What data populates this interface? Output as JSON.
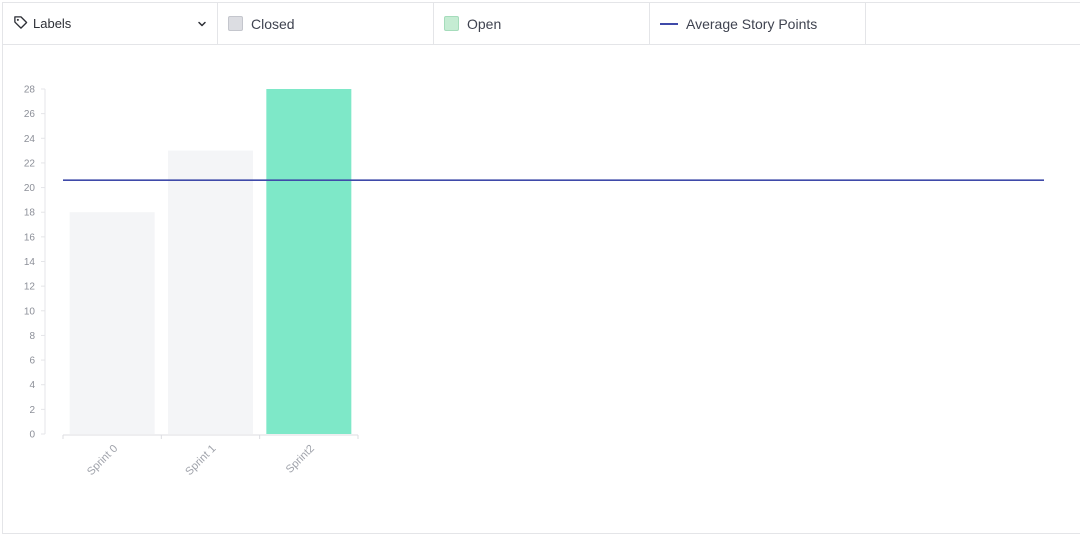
{
  "toolbar": {
    "dropdown_label": "Labels",
    "legend_closed": "Closed",
    "legend_open": "Open",
    "legend_average": "Average Story Points"
  },
  "colors": {
    "closed": "#f4f5f7",
    "open": "#7ee8c8",
    "average": "#3f4aa9",
    "axis_text": "#8c8f98"
  },
  "chart_data": {
    "type": "bar",
    "categories": [
      "Sprint 0",
      "Sprint 1",
      "Sprint2"
    ],
    "series": [
      {
        "name": "Closed",
        "values": [
          18,
          23,
          0
        ]
      },
      {
        "name": "Open",
        "values": [
          0,
          0,
          28
        ]
      }
    ],
    "average_line": {
      "name": "Average Story Points",
      "value": 20.6
    },
    "ylim": [
      0,
      28
    ],
    "yticks": [
      0,
      2,
      4,
      6,
      8,
      10,
      12,
      14,
      16,
      18,
      20,
      22,
      24,
      26,
      28
    ],
    "grid": false,
    "legend_placement": "top"
  }
}
